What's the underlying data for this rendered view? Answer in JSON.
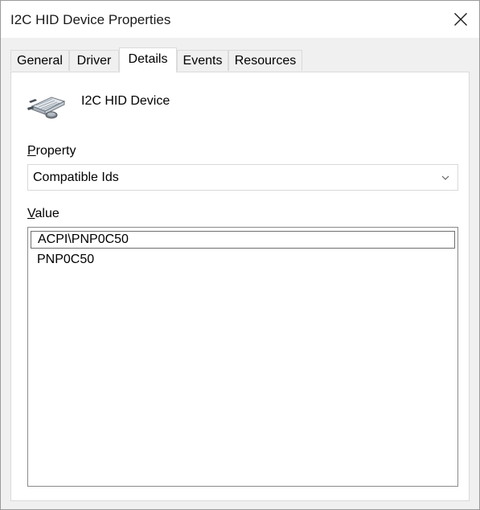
{
  "window": {
    "title": "I2C HID Device Properties"
  },
  "tabs": [
    {
      "label": "General"
    },
    {
      "label": "Driver"
    },
    {
      "label": "Details"
    },
    {
      "label": "Events"
    },
    {
      "label": "Resources"
    }
  ],
  "active_tab": "Details",
  "device": {
    "name": "I2C HID Device",
    "icon": "hid-device-icon"
  },
  "property": {
    "label_underlined": "P",
    "label_rest": "roperty",
    "selected": "Compatible Ids"
  },
  "value": {
    "label_underlined": "V",
    "label_rest": "alue",
    "items": [
      {
        "text": "ACPI\\PNP0C50"
      },
      {
        "text": "PNP0C50"
      }
    ]
  },
  "colors": {
    "window_bg": "#f0f0f0",
    "panel_bg": "#ffffff",
    "border": "#dadada"
  }
}
